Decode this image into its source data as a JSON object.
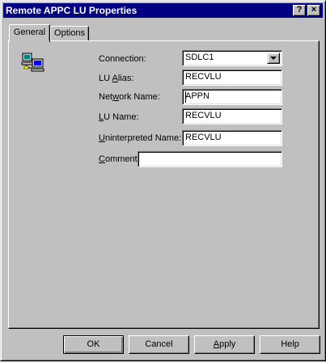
{
  "window": {
    "title": "Remote APPC LU Properties",
    "help_glyph": "?",
    "close_glyph": "×"
  },
  "tabs": [
    {
      "label": "General"
    },
    {
      "label": "Options"
    }
  ],
  "form": {
    "connection": {
      "label": "Connection:",
      "value": "SDLC1"
    },
    "lu_alias": {
      "label_pre": "LU ",
      "label_u": "A",
      "label_post": "lias:",
      "value": "RECVLU"
    },
    "network_name": {
      "label_pre": "Net",
      "label_u": "w",
      "label_post": "ork Name:",
      "value": "APPN"
    },
    "lu_name": {
      "label_pre": "",
      "label_u": "L",
      "label_post": "U Name:",
      "value": "RECVLU"
    },
    "uninterpreted_name": {
      "label_pre": "",
      "label_u": "U",
      "label_post": "ninterpreted Name:",
      "value": "RECVLU"
    },
    "comment": {
      "label_pre": "",
      "label_u": "C",
      "label_post": "omment:",
      "value": ""
    }
  },
  "buttons": {
    "ok": "OK",
    "cancel": "Cancel",
    "apply_u": "A",
    "apply_rest": "pply",
    "help": "Help"
  },
  "icons": {
    "lu_icon": "computers-network-icon"
  },
  "colors": {
    "titlebar": "#000080",
    "face": "#c0c0c0"
  }
}
